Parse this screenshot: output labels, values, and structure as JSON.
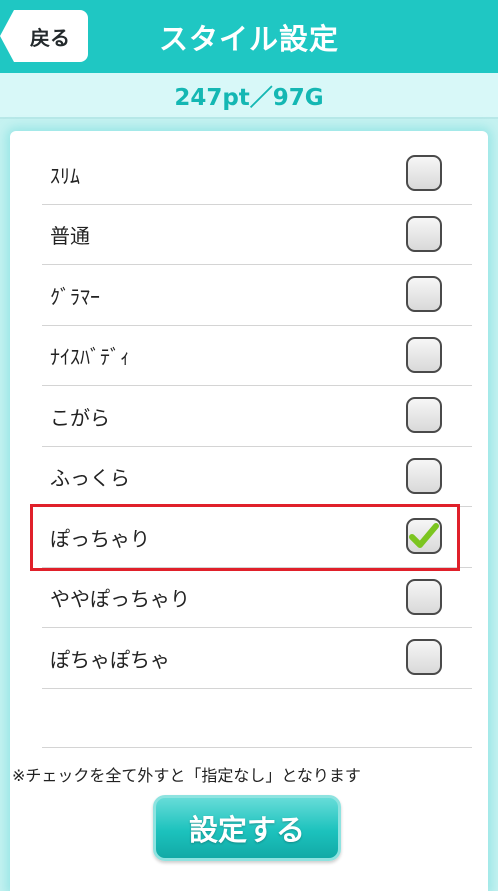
{
  "header": {
    "back_label": "戻る",
    "title": "スタイル設定"
  },
  "points": "247pt／97G",
  "options": [
    {
      "label": "ｽﾘﾑ",
      "checked": false
    },
    {
      "label": "普通",
      "checked": false
    },
    {
      "label": "ｸﾞﾗﾏｰ",
      "checked": false
    },
    {
      "label": "ﾅｲｽﾊﾞﾃﾞｨ",
      "checked": false
    },
    {
      "label": "こがら",
      "checked": false
    },
    {
      "label": "ふっくら",
      "checked": false
    },
    {
      "label": "ぽっちゃり",
      "checked": true
    },
    {
      "label": "ややぽっちゃり",
      "checked": false
    },
    {
      "label": "ぽちゃぽちゃ",
      "checked": false
    }
  ],
  "note": "※チェックを全て外すと「指定なし」となります",
  "submit_label": "設定する",
  "colors": {
    "accent": "#1fc7c3",
    "check": "#7cc520",
    "highlight": "#e0202a"
  },
  "icons": {
    "back": "back-arrow-icon",
    "check": "checkmark-icon"
  }
}
